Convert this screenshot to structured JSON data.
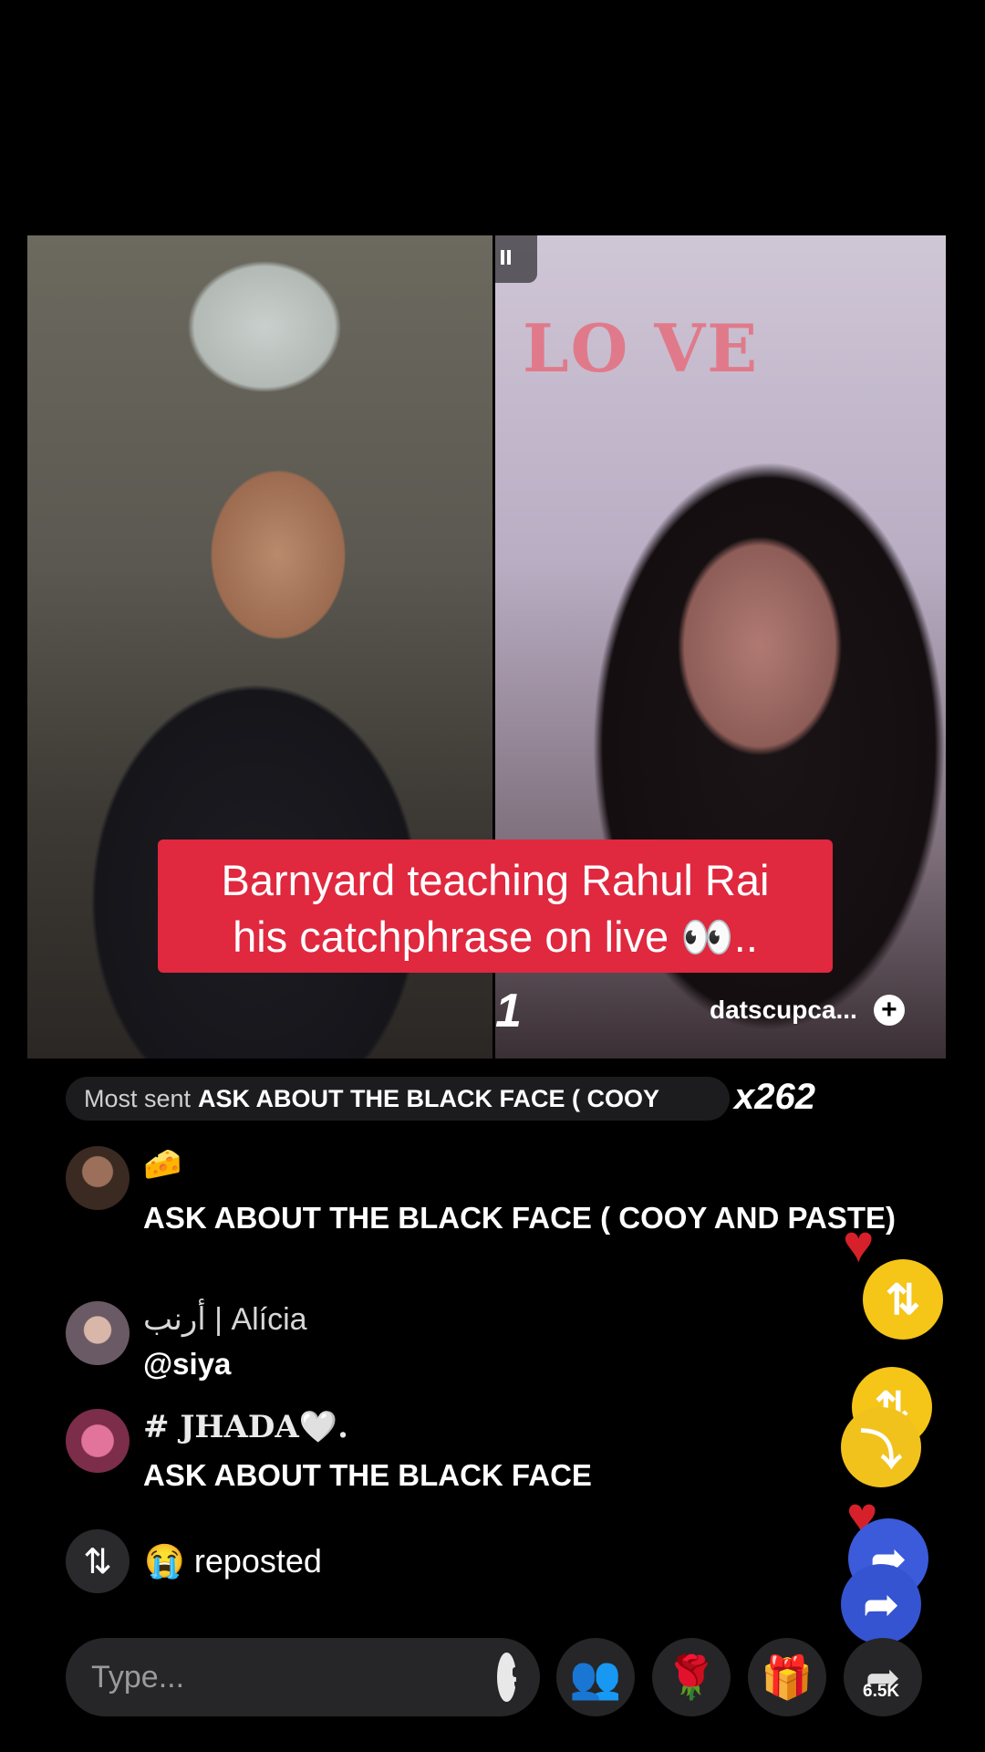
{
  "caption": {
    "line1": "Barnyard teaching Rahul Rai",
    "line2": "his catchphrase on live 👀.."
  },
  "right_video": {
    "host_name": "datscupca...",
    "score_fragment": "1",
    "sign_text": "LO VE"
  },
  "most_sent": {
    "label": "Most sent",
    "value": "ASK ABOUT THE BLACK FACE ( COOY",
    "multiplier": "x262"
  },
  "comments": [
    {
      "name": "🧀",
      "text": "ASK ABOUT THE BLACK FACE ( COOY AND PASTE)"
    },
    {
      "name": "أرنب | Alícia",
      "text": "@siya"
    },
    {
      "name": "# JHADA🤍.",
      "text": "ASK ABOUT THE BLACK FACE"
    }
  ],
  "repost": {
    "text": "😭 reposted",
    "icon": "repost-icon"
  },
  "bottom_bar": {
    "input_placeholder": "Type...",
    "share_count": "6.5K"
  },
  "colors": {
    "caption_bg": "#e0283f",
    "repost_float": "#f5c518",
    "share_float": "#3b5bdb",
    "heart": "#d6202a"
  }
}
